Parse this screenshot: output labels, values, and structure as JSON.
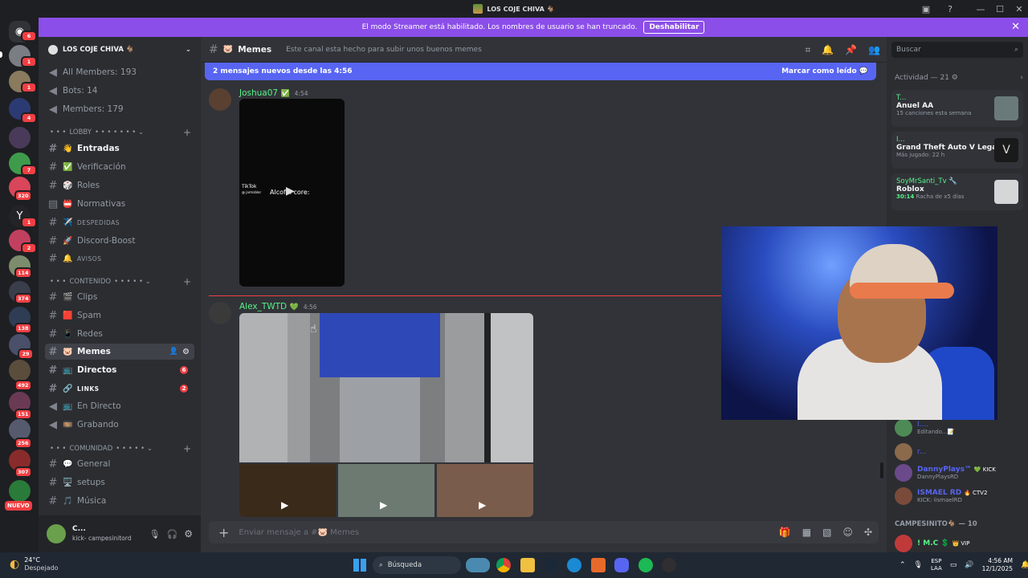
{
  "window": {
    "title": "LOS COJE CHIVA 🐐"
  },
  "banner": {
    "text": "El modo Streamer está habilitado. Los nombres de usuario se han truncado.",
    "button": "Deshabilitar"
  },
  "server_badges": [
    "6",
    "1",
    "1",
    "4",
    "7",
    "320",
    "1",
    "2",
    "114",
    "374",
    "138",
    "29",
    "492",
    "151",
    "256",
    "307"
  ],
  "new_label": "NUEVO",
  "sidebar": {
    "server_name": "LOS COJE CHIVA 🐐",
    "stats": [
      "All Members: 193",
      "Bots: 14",
      "Members: 179"
    ],
    "cat_lobby": "LOBBY",
    "lobby": [
      {
        "emoji": "👋",
        "label": "Entradas"
      },
      {
        "emoji": "✅",
        "label": "Verificación"
      },
      {
        "emoji": "🎲",
        "label": "Roles"
      },
      {
        "emoji": "📛",
        "label": "Normativas"
      },
      {
        "emoji": "✈️",
        "label": "DESPEDIDAS"
      },
      {
        "emoji": "🚀",
        "label": "Discord-Boost"
      },
      {
        "emoji": "🔔",
        "label": "AVISOS"
      }
    ],
    "cat_contenido": "CONTENIDO",
    "contenido": [
      {
        "emoji": "🎬",
        "label": "Clips"
      },
      {
        "emoji": "🟥",
        "label": "Spam"
      },
      {
        "emoji": "📱",
        "label": "Redes"
      },
      {
        "emoji": "🐷",
        "label": "Memes"
      },
      {
        "emoji": "📺",
        "label": "Directos",
        "badge": "6"
      },
      {
        "emoji": "🔗",
        "label": "LINKS",
        "badge": "2"
      },
      {
        "emoji": "📺",
        "label": "En Directo"
      },
      {
        "emoji": "🎞️",
        "label": "Grabando"
      }
    ],
    "cat_comunidad": "COMUNIDAD",
    "comunidad": [
      {
        "emoji": "💬",
        "label": "General"
      },
      {
        "emoji": "🖥️",
        "label": "setups"
      },
      {
        "emoji": "🎵",
        "label": "Música"
      }
    ]
  },
  "user": {
    "name": "C...",
    "status": "kick- campesinitord"
  },
  "chat": {
    "channel": "Memes",
    "topic": "Este canal esta hecho para subir unos buenos memes",
    "newbar": "2 mensajes nuevos desde las 4:56",
    "mark_read": "Marcar como leído",
    "msg1": {
      "user": "Joshua07",
      "time": "4:54",
      "video_text": "Alcofol core:",
      "tiktok": "TikTok",
      "tiktok_user": "@ jarmsblor"
    },
    "msg2": {
      "user": "Alex_TWTD",
      "time": "4:56"
    },
    "composer": "Enviar mensaje a #🐷 Memes"
  },
  "right": {
    "search": "Buscar",
    "activity_title": "Actividad — 21",
    "activities": [
      {
        "name": "T...",
        "game": "Anuel AA",
        "sub": "15 canciones esta semana"
      },
      {
        "name": "I...",
        "game": "Grand Theft Auto V Legacy",
        "sub": "Más jugado: 22 h"
      },
      {
        "name": "SoyMrSanti_Tv 🔧",
        "game": "Roblox",
        "sub": "30:14",
        "sub2": "Racha de x5 días"
      }
    ],
    "members": [
      {
        "name": "I....",
        "sub": "Editando...📝"
      },
      {
        "name": "r...",
        "sub": ""
      },
      {
        "name": "DannyPlays™",
        "tag": "💚 KICK",
        "sub": "DannyPlaysRD"
      },
      {
        "name": "ISMAEL RD",
        "tag": "🔥 CTV2",
        "sub": "KICK: iismaelRD"
      }
    ],
    "section": "CAMPESINITO🐐 — 10",
    "last_member": "! M.C 💲",
    "last_tag": "👑 VIP"
  },
  "taskbar": {
    "temp": "24°C",
    "weather": "Despejado",
    "search": "Búsqueda",
    "lang1": "ESP",
    "lang2": "LAA",
    "time": "4:56 AM",
    "date": "12/1/2025"
  },
  "colors": {
    "accent": "#5865f2",
    "streamer": "#8b4ee8",
    "online": "#57f287",
    "unread": "#f23f43"
  }
}
